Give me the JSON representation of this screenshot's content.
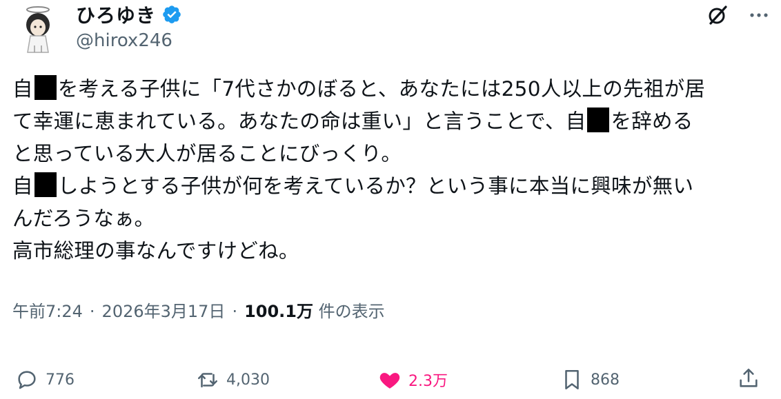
{
  "author": {
    "display_name": "ひろゆき",
    "handle": "@hirox246",
    "verified_color": "#1d9bf0"
  },
  "post": {
    "lines": [
      [
        "自",
        "を考える子供に「7代さかのぼると、あなたには250人以上の先祖が居"
      ],
      [
        "て幸運に恵まれている。あなたの命は重い」と言うことで、自",
        "を辞める"
      ],
      [
        "と思っている大人が居ることにびっくり。"
      ],
      [
        "自",
        "しようとする子供が何を考えているか？という事に本当に興味が無い"
      ],
      [
        "んだろうなぁ。"
      ],
      [
        "高市総理の事なんですけどね。"
      ]
    ]
  },
  "meta": {
    "time": "午前7:24",
    "date": "2026年3月17日",
    "views": "100.1万",
    "views_label": "件の表示",
    "separator": "·"
  },
  "actions": {
    "replies": "776",
    "reposts": "4,030",
    "likes": "2.3万",
    "bookmarks": "868",
    "like_color": "#f91880"
  },
  "icons": [
    "grok-icon",
    "more-icon",
    "reply-icon",
    "repost-icon",
    "heart-icon",
    "bookmark-icon",
    "share-icon",
    "verified-badge-icon"
  ]
}
